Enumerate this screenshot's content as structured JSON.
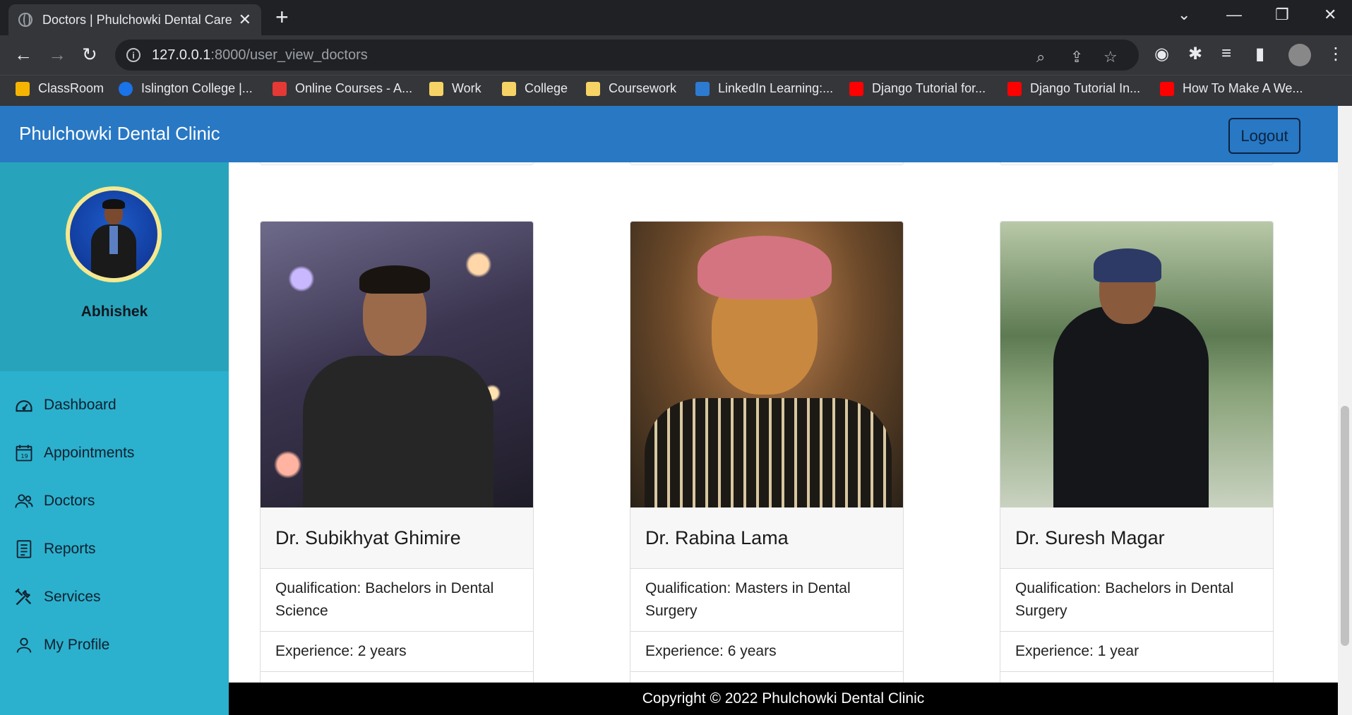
{
  "browser": {
    "tab_title": "Doctors | Phulchowki Dental Care",
    "url_host": "127.0.0.1",
    "url_rest": ":8000/user_view_doctors",
    "bookmarks": [
      {
        "label": "ClassRoom",
        "color": "#f4b400"
      },
      {
        "label": "Islington College |...",
        "color": "#1a73e8"
      },
      {
        "label": "Online Courses - A...",
        "color": "#e53935"
      },
      {
        "label": "Work",
        "color": "#f6d365"
      },
      {
        "label": "College",
        "color": "#f6d365"
      },
      {
        "label": "Coursework",
        "color": "#f6d365"
      },
      {
        "label": "LinkedIn Learning:...",
        "color": "#2c7bd0"
      },
      {
        "label": "Django Tutorial for...",
        "color": "#ff0000"
      },
      {
        "label": "Django Tutorial In...",
        "color": "#ff0000"
      },
      {
        "label": "How To Make A We...",
        "color": "#ff0000"
      }
    ]
  },
  "navbar": {
    "brand": "Phulchowki Dental Clinic",
    "logout_label": "Logout"
  },
  "sidebar": {
    "username": "Abhishek",
    "items": [
      {
        "label": "Dashboard",
        "icon": "dashboard-icon"
      },
      {
        "label": "Appointments",
        "icon": "calendar-icon"
      },
      {
        "label": "Doctors",
        "icon": "users-icon"
      },
      {
        "label": "Reports",
        "icon": "report-icon"
      },
      {
        "label": "Services",
        "icon": "tools-icon"
      },
      {
        "label": "My Profile",
        "icon": "user-icon"
      }
    ]
  },
  "doctors": [
    {
      "name": "Dr. Subikhyat Ghimire",
      "qualification": "Qualification: Bachelors in Dental Science",
      "experience": "Experience: 2 years"
    },
    {
      "name": "Dr. Rabina Lama",
      "qualification": "Qualification: Masters in Dental Surgery",
      "experience": "Experience: 6 years"
    },
    {
      "name": "Dr. Suresh Magar",
      "qualification": "Qualification: Bachelors in Dental Surgery",
      "experience": "Experience: 1 year"
    }
  ],
  "footer": {
    "text": "Copyright © 2022 Phulchowki Dental Clinic"
  },
  "colors": {
    "navbar": "#2878c4",
    "sidebar": "#2bb1cd",
    "sidebar_profile": "#27a4bc"
  }
}
